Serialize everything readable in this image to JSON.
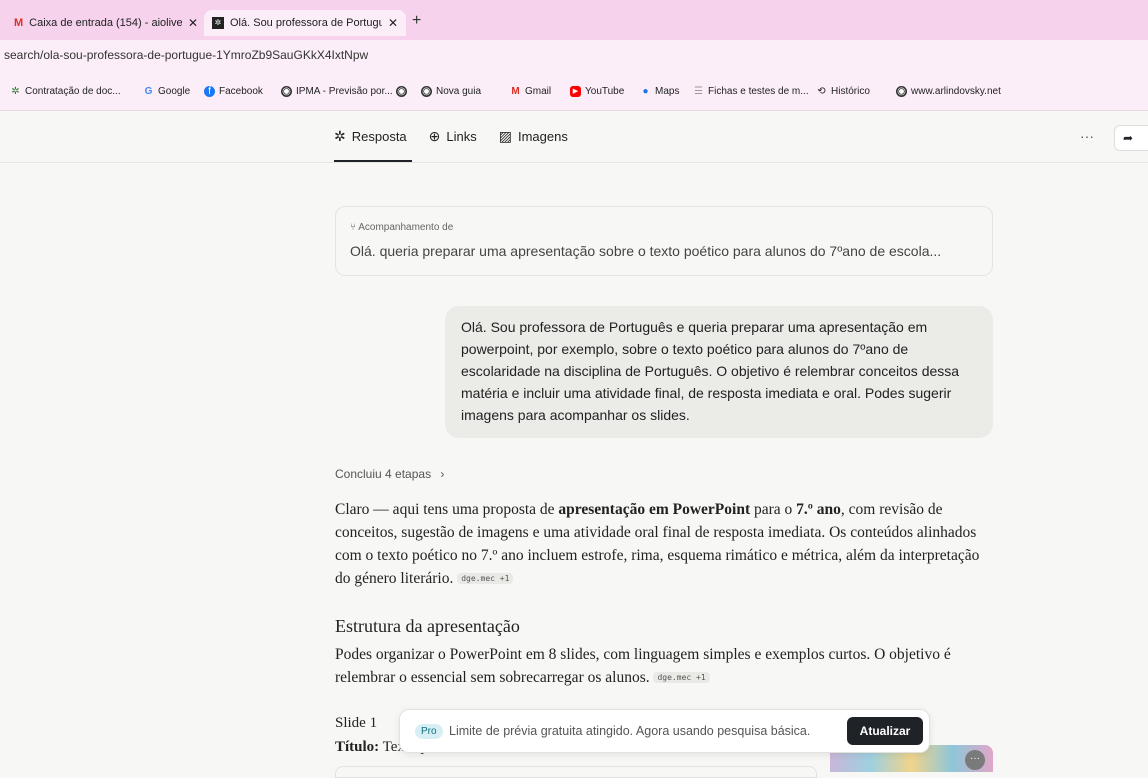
{
  "browser": {
    "tabs": [
      {
        "label": "Caixa de entrada (154) - aiolive",
        "icon": "gmail-icon"
      },
      {
        "label": "Olá. Sou professora de Portugu",
        "icon": "perplexity-icon"
      }
    ],
    "close": "✕",
    "new_tab": "+",
    "address": "search/ola-sou-professora-de-portugue-1YmroZb9SauGKkX4IxtNpw",
    "bookmarks": [
      "Contratação de doc...",
      "Google",
      "Facebook",
      "IPMA - Previsão por...",
      "",
      "Nova guia",
      "Gmail",
      "YouTube",
      "Maps",
      "Fichas e testes de m...",
      "Histórico",
      "www.arlindovsky.net"
    ]
  },
  "page": {
    "nav_tabs": [
      {
        "label": "Resposta",
        "icon": "perplexity-icon"
      },
      {
        "label": "Links",
        "icon": "globe-icon"
      },
      {
        "label": "Imagens",
        "icon": "image-icon"
      }
    ],
    "more": "···",
    "follow_label": "Acompanhamento de",
    "follow_text": "Olá. queria preparar uma apresentação sobre o texto poético para alunos do 7ºano de escola...",
    "user_message": "Olá. Sou professora de Português e queria preparar uma apresentação em powerpoint, por exemplo, sobre o texto poético para alunos do 7ºano de escolaridade na disciplina de Português. O objetivo é relembrar conceitos dessa matéria e incluir uma atividade final, de resposta imediata e oral. Podes sugerir imagens para acompanhar os slides.",
    "steps": "Concluiu 4 etapas",
    "steps_chevron": "›",
    "answer": {
      "p1_a": "Claro — aqui tens uma proposta de ",
      "p1_b": "apresentação em PowerPoint",
      "p1_c": " para o ",
      "p1_d": "7.º ano",
      "p1_e": ", com revisão de conceitos, sugestão de imagens e uma atividade oral final de resposta imediata. Os conteúdos alinhados com o texto poético no 7.º ano incluem estrofe, rima, esquema rimático e métrica, além da interpretação do género literário.",
      "cite": "dge.mec +1",
      "heading": "Estrutura da apresentação",
      "p2": "Podes organizar o PowerPoint em 8 slides, com linguagem simples e exemplos curtos. O objetivo é relembrar o essencial sem sobrecarregar os alunos.",
      "slide1": "Slide 1",
      "titulo_label": "Título:",
      "titulo_value": "Texto poético"
    },
    "toast": {
      "badge": "Pro",
      "message": "Limite de prévia gratuita atingido. Agora usando pesquisa básica.",
      "button": "Atualizar"
    },
    "thumb_more": "···"
  }
}
